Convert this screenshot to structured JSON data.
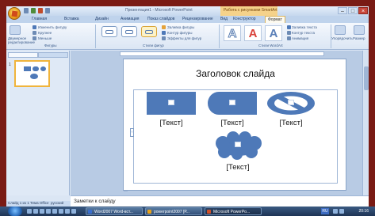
{
  "window": {
    "title": "Презентация1 - Microsoft PowerPoint",
    "contextual_tab_group": "Работа с рисунками SmartArt"
  },
  "ribbon": {
    "tabs": [
      "Главная",
      "Вставка",
      "Дизайн",
      "Анимация",
      "Показ слайдов",
      "Рецензирование",
      "Вид",
      "Конструктор",
      "Формат"
    ],
    "active_tab": "Формат",
    "groups": {
      "shapes": {
        "label": "Фигуры",
        "change_shape": "Изменить фигуру",
        "larger": "Крупнее",
        "smaller": "Меньше",
        "edit_2d": "Двумерное редактирование"
      },
      "shape_styles": {
        "label": "Стили фигур",
        "fill": "Заливка фигуры",
        "outline": "Контур фигуры",
        "effects": "Эффекты для фигур"
      },
      "wordart_styles": {
        "label": "Стили WordArt",
        "text_fill": "Заливка текста",
        "text_outline": "Контур текста",
        "text_effects": "Анимация"
      },
      "arrange": {
        "label": "Упорядочить"
      },
      "size": {
        "label": "Размер"
      }
    }
  },
  "slides_pane": {
    "slide_number": "1"
  },
  "slide": {
    "title": "Заголовок слайда",
    "items": [
      {
        "shape": "rectangle",
        "label": "[Текст]"
      },
      {
        "shape": "rounded",
        "label": "[Текст]"
      },
      {
        "shape": "no-symbol",
        "label": "[Текст]"
      },
      {
        "shape": "cloud",
        "label": "[Текст]"
      }
    ]
  },
  "notes": {
    "placeholder": "Заметки к слайду"
  },
  "statusbar": {
    "slide_info": "Слайд 1 из 1",
    "theme": "Тема Office",
    "language": "русский"
  },
  "taskbar": {
    "items": [
      "Word2007 Word-вст...",
      "powerpoint2007 [Р...",
      "Microsoft PowerPo..."
    ],
    "language": "RU",
    "clock": "20:16"
  },
  "colors": {
    "accent": "#4e79b8",
    "desktop_frame": "#7a1b14",
    "ribbon_bg": "#dbe6f4",
    "contextual_tab": "#f5d28a"
  }
}
